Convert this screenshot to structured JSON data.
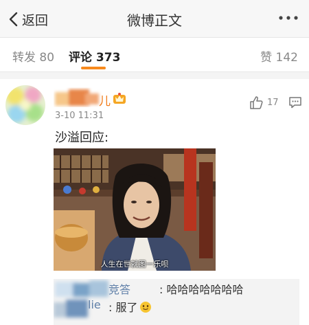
{
  "nav": {
    "back_label": "返回",
    "title": "微博正文",
    "more_icon": "more-dots-icon"
  },
  "tabs": [
    {
      "label": "转发 80"
    },
    {
      "label": "评论 373"
    },
    {
      "label": "赞 142"
    }
  ],
  "colors": {
    "accent_orange": "#f78a1d",
    "username_orange": "#f07d1d",
    "link_blue": "#5f7fa8"
  },
  "comment": {
    "author_visible": "儿",
    "timestamp": "3-10 11:31",
    "likes": "17",
    "text": "沙溢回应:",
    "image_caption": "人生在世就图一乐呗",
    "replies": [
      {
        "name_visible": "竞答",
        "text": ": 哈哈哈哈哈哈哈"
      },
      {
        "name_visible": "lie",
        "text": ": 服了",
        "emoji": "smiling-face-emoji"
      }
    ]
  }
}
